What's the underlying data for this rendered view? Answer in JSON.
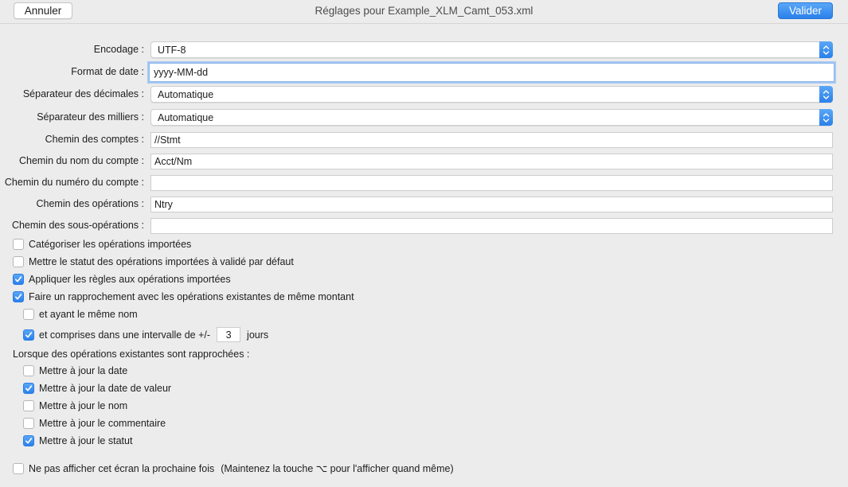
{
  "window": {
    "title": "Réglages pour Example_XLM_Camt_053.xml",
    "cancel_label": "Annuler",
    "ok_label": "Valider"
  },
  "fields": {
    "encoding": {
      "label": "Encodage :",
      "value": "UTF-8"
    },
    "date_format": {
      "label": "Format de date :",
      "value": "yyyy-MM-dd"
    },
    "decimal_separator": {
      "label": "Séparateur des décimales :",
      "value": "Automatique"
    },
    "thousands_separator": {
      "label": "Séparateur des milliers :",
      "value": "Automatique"
    },
    "accounts_path": {
      "label": "Chemin des comptes :",
      "value": "//Stmt"
    },
    "account_name_path": {
      "label": "Chemin du nom du compte :",
      "value": "Acct/Nm"
    },
    "account_number_path": {
      "label": "Chemin du numéro du compte :",
      "value": ""
    },
    "transactions_path": {
      "label": "Chemin des opérations :",
      "value": "Ntry"
    },
    "subtransactions_path": {
      "label": "Chemin des sous-opérations :",
      "value": ""
    }
  },
  "options": {
    "categorize": {
      "label": "Catégoriser les opérations importées",
      "checked": false
    },
    "set_validated": {
      "label": "Mettre le statut des opérations importées à validé par défaut",
      "checked": false
    },
    "apply_rules": {
      "label": "Appliquer les règles aux opérations importées",
      "checked": true
    },
    "reconcile": {
      "label": "Faire un rapprochement avec les opérations existantes de même montant",
      "checked": true
    },
    "same_name": {
      "label": "et ayant le même nom",
      "checked": false
    },
    "within_interval": {
      "label": "et comprises dans une intervalle de +/-",
      "checked": true,
      "days_value": "3",
      "days_unit": "jours"
    }
  },
  "reconciled_section": {
    "title": "Lorsque des opérations existantes sont rapprochées :",
    "items": [
      {
        "label": "Mettre à jour la date",
        "checked": false
      },
      {
        "label": "Mettre à jour la date de valeur",
        "checked": true
      },
      {
        "label": "Mettre à jour le nom",
        "checked": false
      },
      {
        "label": "Mettre à jour le commentaire",
        "checked": false
      },
      {
        "label": "Mettre à jour le statut",
        "checked": true
      }
    ]
  },
  "footer": {
    "dont_show_label": "Ne pas afficher cet écran la prochaine fois",
    "dont_show_checked": false,
    "hint": "(Maintenez la touche ⌥ pour l'afficher quand même)"
  },
  "icons": {
    "checkmark": "checkmark-icon",
    "stepper": "updown-chevron-icon"
  }
}
